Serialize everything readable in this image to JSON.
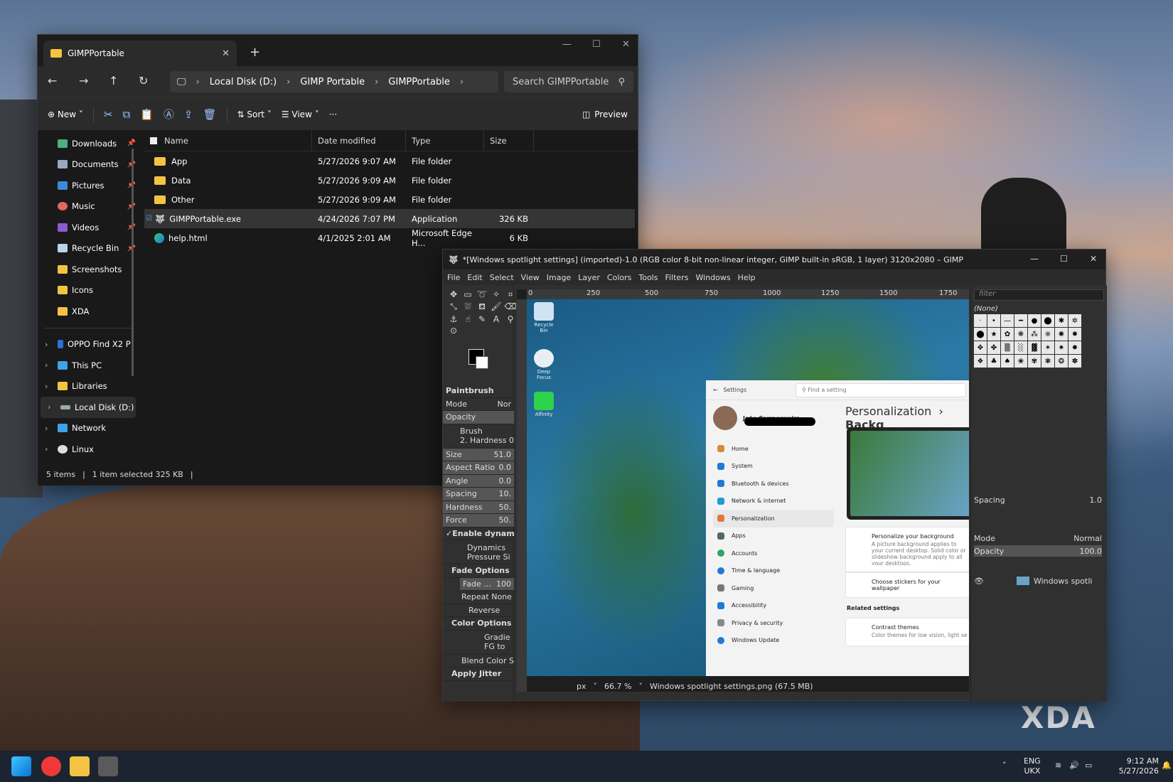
{
  "explorer": {
    "tab_title": "GIMPPortable",
    "breadcrumb": [
      "Local Disk (D:)",
      "GIMP Portable",
      "GIMPPortable"
    ],
    "search_placeholder": "Search GIMPPortable",
    "toolbar": {
      "new": "New",
      "sort": "Sort",
      "view": "View",
      "more": "···",
      "preview": "Preview"
    },
    "nav_pinned": [
      "Downloads",
      "Documents",
      "Pictures",
      "Music",
      "Videos",
      "Recycle Bin",
      "Screenshots",
      "Icons",
      "XDA"
    ],
    "nav_tree": [
      "OPPO Find X2 P",
      "This PC",
      "Libraries",
      "Local Disk (D:)",
      "Network",
      "Linux"
    ],
    "columns": [
      "Name",
      "Date modified",
      "Type",
      "Size"
    ],
    "files": [
      {
        "name": "App",
        "date": "5/27/2026 9:07 AM",
        "type": "File folder",
        "size": ""
      },
      {
        "name": "Data",
        "date": "5/27/2026 9:09 AM",
        "type": "File folder",
        "size": ""
      },
      {
        "name": "Other",
        "date": "5/27/2026 9:09 AM",
        "type": "File folder",
        "size": ""
      },
      {
        "name": "GIMPPortable.exe",
        "date": "4/24/2026 7:07 PM",
        "type": "Application",
        "size": "326 KB"
      },
      {
        "name": "help.html",
        "date": "4/1/2025 2:01 AM",
        "type": "Microsoft Edge H...",
        "size": "6 KB"
      }
    ],
    "status": {
      "items": "5 items",
      "selected": "1 item selected  325 KB"
    }
  },
  "gimp": {
    "title": "*[Windows spotlight settings] (imported)-1.0 (RGB color 8-bit non-linear integer, GIMP built-in sRGB, 1 layer) 3120x2080 – GIMP",
    "menu": [
      "File",
      "Edit",
      "Select",
      "View",
      "Image",
      "Layer",
      "Colors",
      "Tools",
      "Filters",
      "Windows",
      "Help"
    ],
    "ruler": [
      "0",
      "250",
      "500",
      "750",
      "1000",
      "1250",
      "1500",
      "1750"
    ],
    "tool_options": {
      "title": "Paintbrush",
      "mode": "Mode",
      "mode_val": "Nor",
      "opacity": "Opacity",
      "brush": "Brush",
      "brush_val": "2. Hardness 0",
      "size": "Size",
      "size_val": "51.0",
      "aspect": "Aspect Ratio",
      "aspect_val": "0.0",
      "angle": "Angle",
      "angle_val": "0.0",
      "spacing": "Spacing",
      "spacing_val": "10.",
      "hardness": "Hardness",
      "hardness_val": "50.",
      "force": "Force",
      "force_val": "50.",
      "enable_dyn": "Enable dynamic",
      "dynamics": "Dynamics",
      "dynamics_val": "Pressure Si",
      "fade": "Fade Options",
      "fade_val": "Fade ...",
      "fade_num": "100",
      "repeat": "Repeat",
      "repeat_val": "None",
      "reverse": "Reverse",
      "color_opts": "Color Options",
      "gradient": "Gradie",
      "fg": "FG to",
      "blend": "Blend Color S",
      "jitter": "Apply Jitter"
    },
    "status": {
      "unit": "px",
      "zoom": "66.7 %",
      "file": "Windows spotlight settings.png (67.5 MB)"
    },
    "dock": {
      "filter": "filter",
      "none": "(None)",
      "spacing": "Spacing",
      "spacing_val": "1.0",
      "mode": "Mode",
      "mode_val": "Normal",
      "opacity": "Opacity",
      "opacity_val": "100.0",
      "layer": "Windows spotli"
    },
    "canvas_desktop": {
      "icons": [
        "Recycle Bin",
        "Deep Focus",
        "Affinity"
      ]
    },
    "settings": {
      "title": "Settings",
      "find": "Find a setting",
      "user": "João Carrasqueira",
      "heading": "Personalization",
      "heading2": "Backg",
      "nav": [
        "Home",
        "System",
        "Bluetooth & devices",
        "Network & internet",
        "Personalization",
        "Apps",
        "Accounts",
        "Time & language",
        "Gaming",
        "Accessibility",
        "Privacy & security",
        "Windows Update"
      ],
      "card1_title": "Personalize your background",
      "card1_sub": "A picture background applies to your current desktop. Solid color or slideshow background apply to all your desktops.",
      "card2": "Choose stickers for your wallpaper",
      "related": "Related settings",
      "card3_title": "Contrast themes",
      "card3_sub": "Color themes for low vision, light sensitivity"
    }
  },
  "taskbar": {
    "lang": "ENG",
    "region": "UKX",
    "time": "9:12 AM",
    "date": "5/27/2026"
  },
  "watermark": "XDA"
}
